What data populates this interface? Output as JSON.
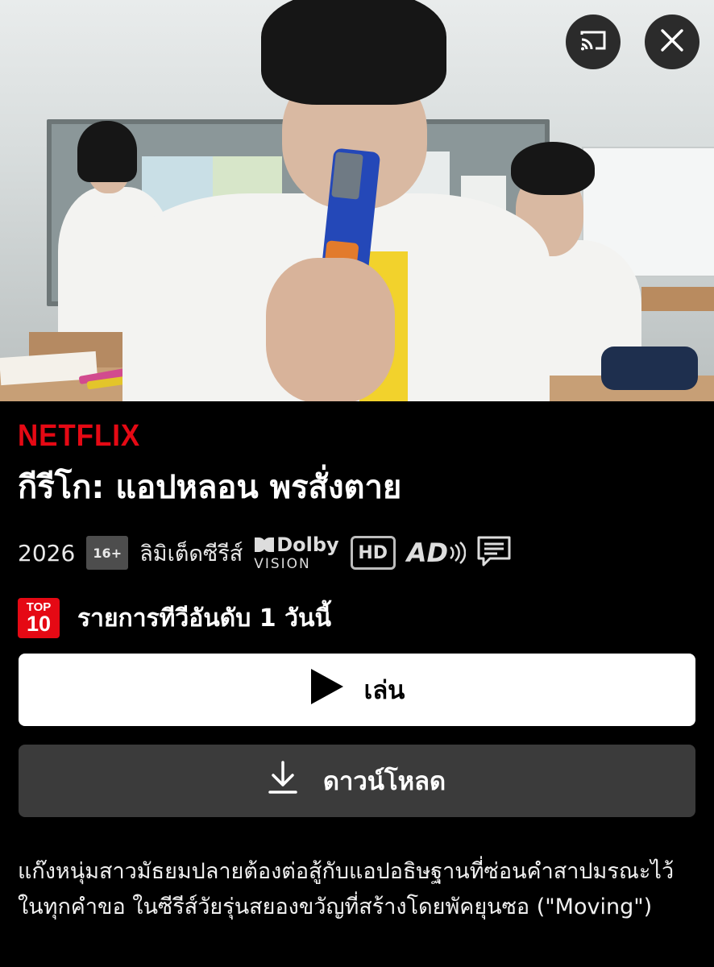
{
  "hero": {
    "cast_icon": "cast-icon",
    "close_icon": "close-icon"
  },
  "brand": {
    "logo_text": "NETFLIX",
    "accent_color": "#e50914"
  },
  "title": "กีรีโก: แอปหลอน พรสั่งตาย",
  "meta": {
    "year": "2026",
    "rating": "16+",
    "type": "ลิมิเต็ดซีรีส์",
    "dolby_line1": "Dolby",
    "dolby_line2": "VISION",
    "hd": "HD",
    "ad": "AD",
    "subtitles_icon": "subtitles-icon"
  },
  "top10": {
    "badge_top": "TOP",
    "badge_num": "10",
    "text": "รายการทีวีอันดับ 1 วันนี้"
  },
  "actions": {
    "play_label": "เล่น",
    "download_label": "ดาวน์โหลด"
  },
  "description": "แก๊งหนุ่มสาวมัธยมปลายต้องต่อสู้กับแอปอธิษฐานที่ซ่อนคำสาปมรณะไว้ในทุกคำขอ ในซีรีส์วัยรุ่นสยองขวัญที่สร้างโดยพัคยุนซอ (\"Moving\")"
}
